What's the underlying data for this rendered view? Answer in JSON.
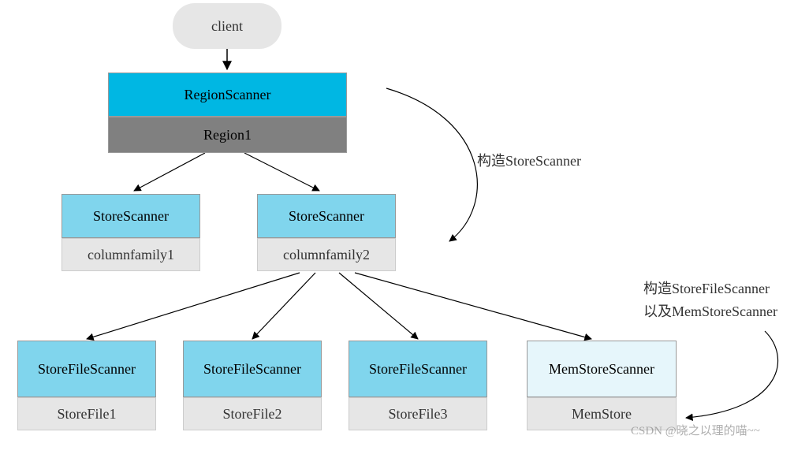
{
  "diagram": {
    "client": "client",
    "region_scanner": "RegionScanner",
    "region1": "Region1",
    "store_scanner_1": {
      "title": "StoreScanner",
      "sub": "columnfamily1"
    },
    "store_scanner_2": {
      "title": "StoreScanner",
      "sub": "columnfamily2"
    },
    "leaf1": {
      "title": "StoreFileScanner",
      "sub": "StoreFile1"
    },
    "leaf2": {
      "title": "StoreFileScanner",
      "sub": "StoreFile2"
    },
    "leaf3": {
      "title": "StoreFileScanner",
      "sub": "StoreFile3"
    },
    "leaf4": {
      "title": "MemStoreScanner",
      "sub": "MemStore"
    },
    "annot1": "构造StoreScanner",
    "annot2_line1": "构造StoreFileScanner",
    "annot2_line2": "以及MemStoreScanner",
    "watermark": "CSDN @晓之以理的喵~~"
  }
}
